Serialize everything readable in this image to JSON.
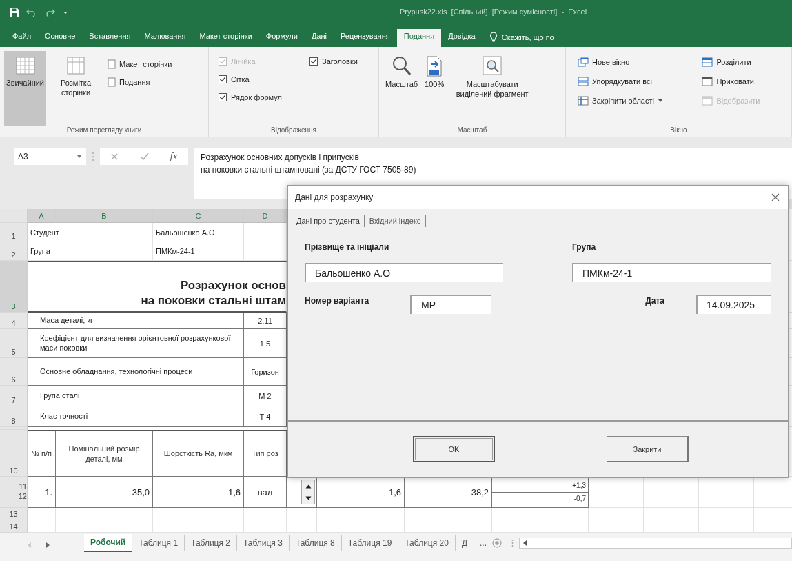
{
  "title_bar": {
    "title": "Prypusk22.xls  [Спільний]  [Режим сумісності]  -  Excel"
  },
  "ribbon_tabs": [
    {
      "label": "Файл",
      "selected": false
    },
    {
      "label": "Основне",
      "selected": false
    },
    {
      "label": "Вставлення",
      "selected": false
    },
    {
      "label": "Малювання",
      "selected": false
    },
    {
      "label": "Макет сторінки",
      "selected": false
    },
    {
      "label": "Формули",
      "selected": false
    },
    {
      "label": "Дані",
      "selected": false
    },
    {
      "label": "Рецензування",
      "selected": false
    },
    {
      "label": "Подання",
      "selected": true
    },
    {
      "label": "Довідка",
      "selected": false
    }
  ],
  "tell_me": "Скажіть, що по",
  "view_group": {
    "label": "Режим перегляду книги",
    "items": [
      {
        "kind": "large",
        "label": "Звичайний",
        "selected": true
      },
      {
        "kind": "large",
        "label": "Розмітка сторінки",
        "selected": false
      },
      {
        "kind": "small",
        "label": "Макет сторінки",
        "selected": false
      },
      {
        "kind": "small",
        "label": "Подання",
        "selected": false
      }
    ]
  },
  "show_group": {
    "label": "Відображення",
    "items": [
      {
        "label": "Лінійка",
        "checked": true,
        "disabled": true
      },
      {
        "label": "Сітка",
        "checked": true,
        "disabled": false
      },
      {
        "label": "Рядок формул",
        "checked": true,
        "disabled": false
      },
      {
        "label": "Заголовки",
        "checked": true,
        "disabled": false
      }
    ]
  },
  "zoom_group": {
    "label": "Масштаб",
    "items": [
      {
        "kind": "zoom",
        "label": "Масштаб"
      },
      {
        "kind": "hundred",
        "label": "100%"
      },
      {
        "kind": "selection",
        "label": "Масштабувати виділений фрагмент"
      }
    ]
  },
  "window_group": {
    "label": "Вікно",
    "items": [
      {
        "kind": "new",
        "label": "Нове вікно",
        "disabled": false,
        "dropdown": false
      },
      {
        "kind": "arrange",
        "label": "Упорядкувати всі",
        "disabled": false,
        "dropdown": false
      },
      {
        "kind": "freeze",
        "label": "Закріпити області",
        "disabled": false,
        "dropdown": true
      },
      {
        "kind": "split",
        "label": "Розділити",
        "disabled": false,
        "dropdown": false
      },
      {
        "kind": "hide",
        "label": "Приховати",
        "disabled": false,
        "dropdown": false
      },
      {
        "kind": "unhide",
        "label": "Відобразити",
        "disabled": true,
        "dropdown": false
      }
    ]
  },
  "formula_bar": {
    "name_box": "A3",
    "function_label": "fx",
    "formula_lines": [
      "Розрахунок основних допусків і припусків",
      "на поковки стальні штамповані (за ДСТУ ГОСТ 7505-89)"
    ]
  },
  "sheet": {
    "columns": [
      {
        "label": "A",
        "selected": true
      },
      {
        "label": "B",
        "selected": true
      },
      {
        "label": "C",
        "selected": true
      },
      {
        "label": "D",
        "selected": true
      }
    ],
    "info_rows": [
      {
        "number": "1",
        "selected": false,
        "label": "Студент",
        "value": "Бальошенко А.О"
      },
      {
        "number": "2",
        "selected": false,
        "label": "Група",
        "value": "ПМКм-24-1"
      }
    ],
    "title_row": {
      "number": "3",
      "selected": true,
      "lines": [
        "Розрахунок основ",
        "на поковки стальні штам"
      ]
    },
    "param_rows": [
      {
        "number": "4",
        "selected": false,
        "label": "Маса деталі, кг",
        "value": "2,11"
      },
      {
        "number": "5",
        "selected": false,
        "label": "Коефіцієнт для визначення орієнтовної розрахункової маси поковки",
        "value": "1,5"
      },
      {
        "number": "6",
        "selected": false,
        "label": "Основне обладнання, технологічні процеси",
        "value": "Горизон"
      },
      {
        "number": "7",
        "selected": false,
        "label": "Група сталі",
        "value": "М 2"
      },
      {
        "number": "8",
        "selected": false,
        "label": "Клас точності",
        "value": "Т 4"
      }
    ],
    "header_row": {
      "number": "10",
      "selected": false,
      "cells": [
        "№ п/п",
        "Номінальний розмір деталі, мм",
        "Шорсткість Ra, мкм",
        "Тип роз"
      ]
    },
    "data_row": {
      "numbers": [
        "11",
        "12"
      ],
      "cells": [
        "1.",
        "35,0",
        "1,6",
        "вал"
      ],
      "column_6": "1,6",
      "column_7": "38,2",
      "upper_deviation": "+1,3",
      "lower_deviation": "-0,7"
    },
    "empty_rows": [
      "13",
      "14"
    ]
  },
  "dialog": {
    "title": "Дані для розрахунку",
    "tabs": [
      {
        "label": "Дані про студента",
        "selected": true
      },
      {
        "label": "Вхідний індекс",
        "selected": false
      }
    ],
    "fields": [
      {
        "kind": "stacked",
        "label": "Прізвище та ініціали",
        "value": "Бальошенко А.О"
      },
      {
        "kind": "stacked",
        "label": "Група",
        "value": "ПМКм-24-1"
      },
      {
        "kind": "inline",
        "label": "Номер варіанта",
        "value": "МР"
      },
      {
        "kind": "inline",
        "label": "Дата",
        "value": "14.09.2025"
      }
    ],
    "buttons": [
      {
        "label": "OK",
        "default": true
      },
      {
        "label": "Закрити",
        "default": false
      }
    ]
  },
  "sheet_tabs": [
    {
      "label": "Робочий",
      "selected": true
    },
    {
      "label": "Таблиця 1",
      "selected": false
    },
    {
      "label": "Таблиця 2",
      "selected": false
    },
    {
      "label": "Таблиця 3",
      "selected": false
    },
    {
      "label": "Таблиця 8",
      "selected": false
    },
    {
      "label": "Таблиця 19",
      "selected": false
    },
    {
      "label": "Таблиця 20",
      "selected": false
    },
    {
      "label": "Д",
      "selected": false
    }
  ],
  "more_tabs": "..."
}
